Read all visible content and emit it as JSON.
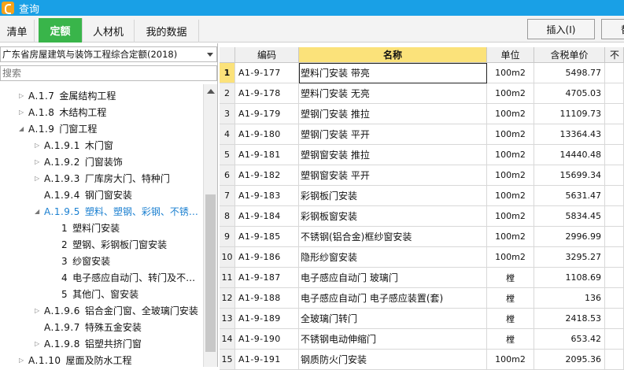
{
  "window": {
    "title": "查询"
  },
  "tabs": [
    {
      "label": "清单",
      "active": false
    },
    {
      "label": "定额",
      "active": true
    },
    {
      "label": "人材机",
      "active": false
    },
    {
      "label": "我的数据",
      "active": false
    }
  ],
  "toolbar": {
    "insert_label": "插入(I)",
    "replace_label": "替"
  },
  "left": {
    "library": "广东省房屋建筑与装饰工程综合定额(2018)",
    "search_placeholder": "搜索",
    "tree": [
      {
        "code": "A.1.7",
        "label": "金属结构工程",
        "expander": "▷",
        "level": 1
      },
      {
        "code": "A.1.8",
        "label": "木结构工程",
        "expander": "▷",
        "level": 1
      },
      {
        "code": "A.1.9",
        "label": "门窗工程",
        "expander": "◢",
        "level": 1
      },
      {
        "code": "A.1.9.1",
        "label": "木门窗",
        "expander": "▷",
        "level": 2
      },
      {
        "code": "A.1.9.2",
        "label": "门窗装饰",
        "expander": "▷",
        "level": 2
      },
      {
        "code": "A.1.9.3",
        "label": "厂库房大门、特种门",
        "expander": "▷",
        "level": 2
      },
      {
        "code": "A.1.9.4",
        "label": "钢门窗安装",
        "expander": "",
        "level": 2
      },
      {
        "code": "A.1.9.5",
        "label": "塑料、塑钢、彩钢、不锈…",
        "expander": "◢",
        "level": 2,
        "selected": true
      },
      {
        "code": "1",
        "label": "塑料门安装",
        "expander": "",
        "level": 3
      },
      {
        "code": "2",
        "label": "塑钢、彩钢板门窗安装",
        "expander": "",
        "level": 3
      },
      {
        "code": "3",
        "label": "纱窗安装",
        "expander": "",
        "level": 3
      },
      {
        "code": "4",
        "label": "电子感应自动门、转门及不…",
        "expander": "",
        "level": 3
      },
      {
        "code": "5",
        "label": "其他门、窗安装",
        "expander": "",
        "level": 3
      },
      {
        "code": "A.1.9.6",
        "label": "铝合金门窗、全玻璃门安装",
        "expander": "▷",
        "level": 2
      },
      {
        "code": "A.1.9.7",
        "label": "特殊五金安装",
        "expander": "",
        "level": 2
      },
      {
        "code": "A.1.9.8",
        "label": "铝塑共挤门窗",
        "expander": "▷",
        "level": 2
      },
      {
        "code": "A.1.10",
        "label": "屋面及防水工程",
        "expander": "▷",
        "level": 1
      }
    ]
  },
  "grid": {
    "headers": {
      "code": "编码",
      "name": "名称",
      "unit": "单位",
      "price": "含税单价",
      "extra": "不"
    },
    "rows": [
      {
        "no": "1",
        "code": "A1-9-177",
        "name": "塑料门安装 带亮",
        "unit": "100m2",
        "price": "5498.77",
        "current": true
      },
      {
        "no": "2",
        "code": "A1-9-178",
        "name": "塑料门安装 无亮",
        "unit": "100m2",
        "price": "4705.03"
      },
      {
        "no": "3",
        "code": "A1-9-179",
        "name": "塑钢门安装 推拉",
        "unit": "100m2",
        "price": "11109.73"
      },
      {
        "no": "4",
        "code": "A1-9-180",
        "name": "塑钢门安装 平开",
        "unit": "100m2",
        "price": "13364.43"
      },
      {
        "no": "5",
        "code": "A1-9-181",
        "name": "塑钢窗安装 推拉",
        "unit": "100m2",
        "price": "14440.48"
      },
      {
        "no": "6",
        "code": "A1-9-182",
        "name": "塑钢窗安装 平开",
        "unit": "100m2",
        "price": "15699.34"
      },
      {
        "no": "7",
        "code": "A1-9-183",
        "name": "彩钢板门安装",
        "unit": "100m2",
        "price": "5631.47"
      },
      {
        "no": "8",
        "code": "A1-9-184",
        "name": "彩钢板窗安装",
        "unit": "100m2",
        "price": "5834.45"
      },
      {
        "no": "9",
        "code": "A1-9-185",
        "name": "不锈钢(铝合金)框纱窗安装",
        "unit": "100m2",
        "price": "2996.99"
      },
      {
        "no": "10",
        "code": "A1-9-186",
        "name": "隐形纱窗安装",
        "unit": "100m2",
        "price": "3295.27"
      },
      {
        "no": "11",
        "code": "A1-9-187",
        "name": "电子感应自动门 玻璃门",
        "unit": "樘",
        "price": "1108.69"
      },
      {
        "no": "12",
        "code": "A1-9-188",
        "name": "电子感应自动门 电子感应装置(套)",
        "unit": "樘",
        "price": "136"
      },
      {
        "no": "13",
        "code": "A1-9-189",
        "name": "全玻璃门转门",
        "unit": "樘",
        "price": "2418.53"
      },
      {
        "no": "14",
        "code": "A1-9-190",
        "name": "不锈钢电动伸缩门",
        "unit": "樘",
        "price": "653.42"
      },
      {
        "no": "15",
        "code": "A1-9-191",
        "name": "钢质防火门安装",
        "unit": "100m2",
        "price": "2095.36"
      }
    ]
  }
}
